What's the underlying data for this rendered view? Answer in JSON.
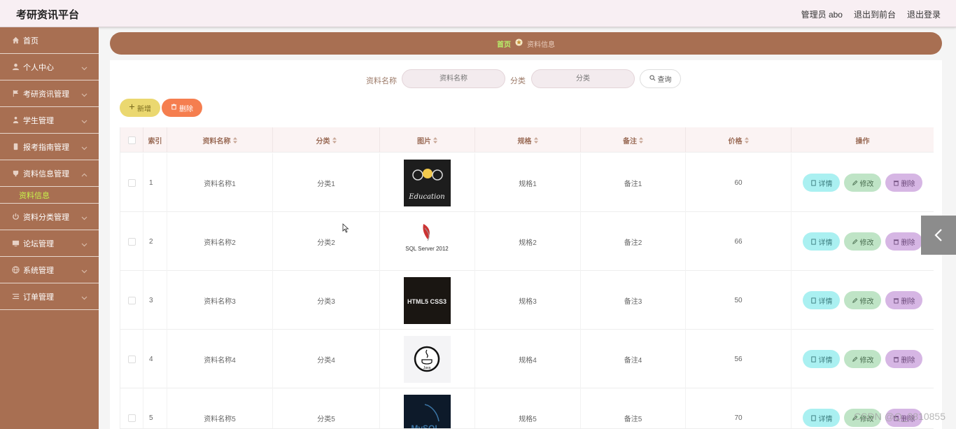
{
  "header": {
    "brand": "考研资讯平台",
    "admin_user": "管理员 abo",
    "to_front": "退出到前台",
    "logout": "退出登录"
  },
  "sidebar": {
    "items": [
      {
        "label": "首页",
        "icon": "home-icon"
      },
      {
        "label": "个人中心",
        "icon": "user-icon"
      },
      {
        "label": "考研资讯管理",
        "icon": "flag-icon"
      },
      {
        "label": "学生管理",
        "icon": "person-icon"
      },
      {
        "label": "报考指南管理",
        "icon": "phone-icon"
      },
      {
        "label": "资料信息管理",
        "icon": "cup-icon"
      },
      {
        "label": "资料分类管理",
        "icon": "power-icon"
      },
      {
        "label": "论坛管理",
        "icon": "monitor-icon"
      },
      {
        "label": "系统管理",
        "icon": "globe-icon"
      },
      {
        "label": "订单管理",
        "icon": "list-icon"
      }
    ],
    "active_sub": "资料信息"
  },
  "breadcrumb": {
    "home": "首页",
    "current": "资料信息"
  },
  "search": {
    "label_name": "资料名称",
    "placeholder_name": "资料名称",
    "label_category": "分类",
    "placeholder_category": "分类",
    "query_button": "查询"
  },
  "actions": {
    "add": "新增",
    "delete": "删除"
  },
  "table": {
    "headers": [
      "索引",
      "资料名称",
      "分类",
      "图片",
      "规格",
      "备注",
      "价格",
      "操作"
    ],
    "rows": [
      {
        "index": "1",
        "name": "资料名称1",
        "category": "分类1",
        "image": "Education",
        "spec": "规格1",
        "note": "备注1",
        "price": "60"
      },
      {
        "index": "2",
        "name": "资料名称2",
        "category": "分类2",
        "image": "SQL Server 2012",
        "spec": "规格2",
        "note": "备注2",
        "price": "66"
      },
      {
        "index": "3",
        "name": "资料名称3",
        "category": "分类3",
        "image": "HTML5 CSS3",
        "spec": "规格3",
        "note": "备注3",
        "price": "50"
      },
      {
        "index": "4",
        "name": "资料名称4",
        "category": "分类4",
        "image": "Java",
        "spec": "规格4",
        "note": "备注4",
        "price": "56"
      },
      {
        "index": "5",
        "name": "资料名称5",
        "category": "分类5",
        "image": "MySQL",
        "spec": "规格5",
        "note": "备注5",
        "price": "70"
      }
    ],
    "op_detail": "详情",
    "op_edit": "修改",
    "op_remove": "删除"
  },
  "watermark": "CSDN @Q_3810855",
  "colors": {
    "brand_brown": "#a86f52",
    "header_bg": "#f8eff3",
    "active_green": "#c7f24b"
  }
}
